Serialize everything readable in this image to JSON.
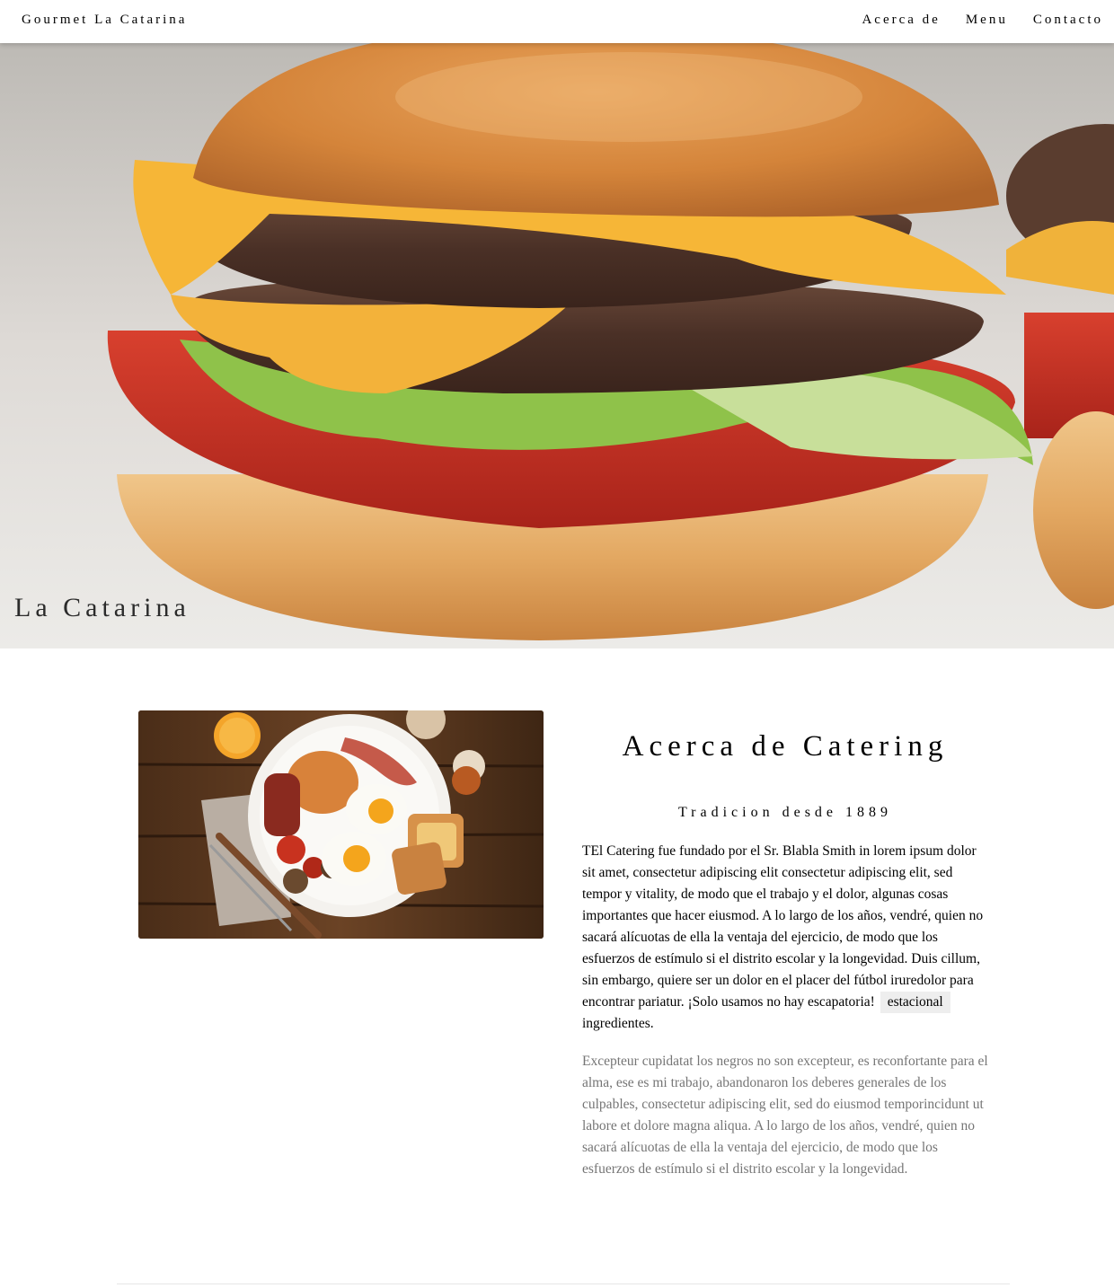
{
  "header": {
    "brand": "Gourmet La Catarina",
    "nav": [
      {
        "label": "Acerca de"
      },
      {
        "label": "Menu"
      },
      {
        "label": "Contacto"
      }
    ]
  },
  "hero": {
    "title": "La Catarina",
    "image": "hamburger-photo"
  },
  "about": {
    "image": "breakfast-plate-photo",
    "heading": "Acerca de Catering",
    "subheading": "Tradicion desde 1889",
    "paragraph1_before": "TEl Catering fue fundado por el Sr. Blabla Smith in lorem ipsum dolor sit amet, consectetur adipiscing elit consectetur adipiscing elit, sed tempor y vitality, de modo que el trabajo y el dolor, algunas cosas importantes que hacer eiusmod. A lo largo de los años, vendré, quien no sacará alícuotas de ella la ventaja del ejercicio, de modo que los esfuerzos de estímulo si el distrito escolar y la longevidad. Duis cillum, sin embargo, quiere ser un dolor en el placer del fútbol iruredolor para encontrar pariatur. ¡Solo usamos no hay escapatoria!",
    "paragraph1_tag": "estacional",
    "paragraph1_after": "ingredientes.",
    "paragraph2": "Excepteur cupidatat los negros no son excepteur, es reconfortante para el alma, ese es mi trabajo, abandonaron los deberes generales de los culpables, consectetur adipiscing elit, sed do eiusmod temporincidunt ut labore et dolore magna aliqua. A lo largo de los años, vendré, quien no sacará alícuotas de ella la ventaja del ejercicio, de modo que los esfuerzos de estímulo si el distrito escolar y la longevidad."
  }
}
